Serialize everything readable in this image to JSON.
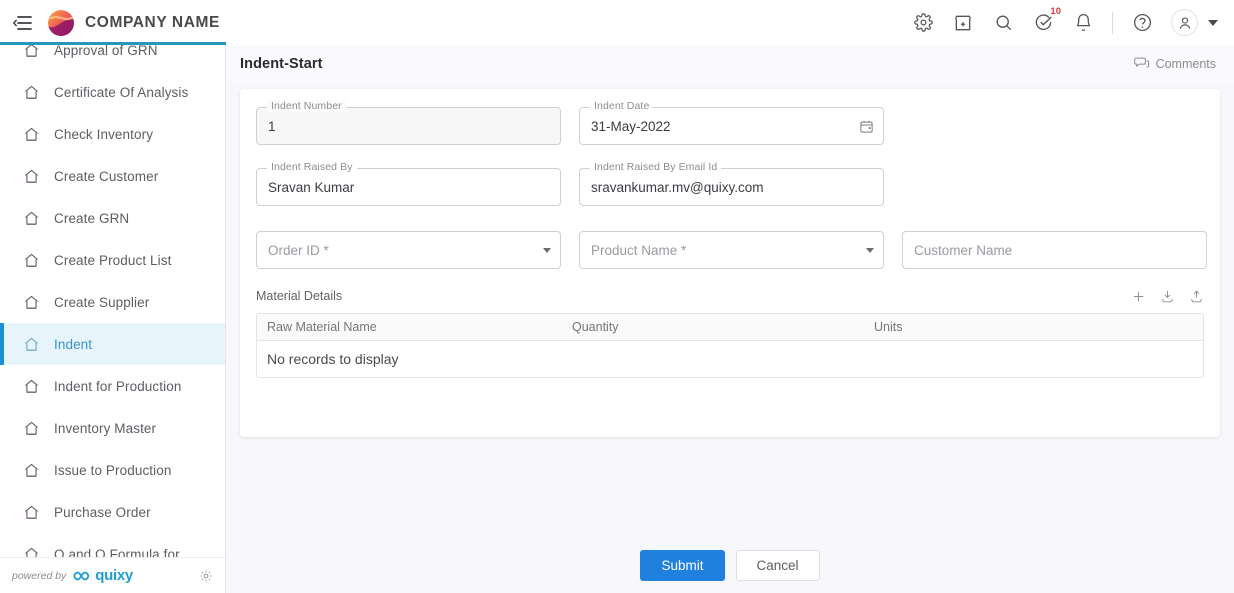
{
  "header": {
    "menu_toggle_icon": "collapse-menu-icon",
    "brand_name": "COMPANY NAME",
    "icons": [
      {
        "name": "gear-icon",
        "label": "Settings"
      },
      {
        "name": "store-icon",
        "label": "Marketplace"
      },
      {
        "name": "search-icon",
        "label": "Search"
      },
      {
        "name": "task-check-icon",
        "label": "Tasks",
        "badge": "10"
      },
      {
        "name": "bell-icon",
        "label": "Notifications"
      },
      {
        "name": "help-icon",
        "label": "Help"
      },
      {
        "name": "user-avatar-icon",
        "label": "Profile"
      }
    ],
    "task_badge": "10"
  },
  "sidebar": {
    "items": [
      {
        "label": "Approval of GRN",
        "icon": "home-icon",
        "active": false
      },
      {
        "label": "Certificate Of Analysis",
        "icon": "home-icon",
        "active": false
      },
      {
        "label": "Check Inventory",
        "icon": "home-icon",
        "active": false
      },
      {
        "label": "Create Customer",
        "icon": "home-icon",
        "active": false
      },
      {
        "label": "Create GRN",
        "icon": "home-icon",
        "active": false
      },
      {
        "label": "Create Product List",
        "icon": "home-icon",
        "active": false
      },
      {
        "label": "Create Supplier",
        "icon": "home-icon",
        "active": false
      },
      {
        "label": "Indent",
        "icon": "home-icon",
        "active": true
      },
      {
        "label": "Indent for Production",
        "icon": "home-icon",
        "active": false
      },
      {
        "label": "Inventory Master",
        "icon": "home-icon",
        "active": false
      },
      {
        "label": "Issue to Production",
        "icon": "home-icon",
        "active": false
      },
      {
        "label": "Purchase Order",
        "icon": "home-icon",
        "active": false
      },
      {
        "label": "Q and Q Formula for",
        "icon": "home-icon",
        "active": false
      }
    ],
    "footer": {
      "powered_by": "powered by",
      "brand": "quixy",
      "gear_icon": "gear-icon"
    }
  },
  "main": {
    "page_title": "Indent-Start",
    "comments_label": "Comments",
    "comments_icon": "comments-icon",
    "fields": {
      "indent_number": {
        "label": "Indent Number",
        "value": "1",
        "readonly": true
      },
      "indent_date": {
        "label": "Indent Date",
        "value": "31-May-2022",
        "trailing_icon": "calendar-icon"
      },
      "indent_raised_by": {
        "label": "Indent Raised By",
        "value": "Sravan Kumar"
      },
      "indent_raised_by_email": {
        "label": "Indent Raised By Email Id",
        "value": "sravankumar.mv@quixy.com"
      },
      "order_id": {
        "placeholder": "Order ID *",
        "value": "",
        "type": "select"
      },
      "product_name": {
        "placeholder": "Product Name *",
        "value": "",
        "type": "select"
      },
      "customer_name": {
        "placeholder": "Customer Name",
        "value": "",
        "type": "text"
      }
    },
    "material_details": {
      "title": "Material Details",
      "actions": [
        {
          "name": "add-row-icon",
          "label": "Add"
        },
        {
          "name": "download-icon",
          "label": "Download"
        },
        {
          "name": "upload-icon",
          "label": "Upload"
        }
      ],
      "columns": [
        "Raw Material Name",
        "Quantity",
        "Units"
      ],
      "rows": [],
      "empty_message": "No records to display"
    },
    "actions": {
      "submit_label": "Submit",
      "cancel_label": "Cancel"
    }
  },
  "colors": {
    "primary": "#1f80dd",
    "accent_bar": "#2596be",
    "active_item_bg": "#e8f4fb",
    "active_item_text": "#3a93c9",
    "badge": "#e8343c",
    "page_bg": "#f8f8fc",
    "quixy_blue": "#1f9ed9"
  }
}
